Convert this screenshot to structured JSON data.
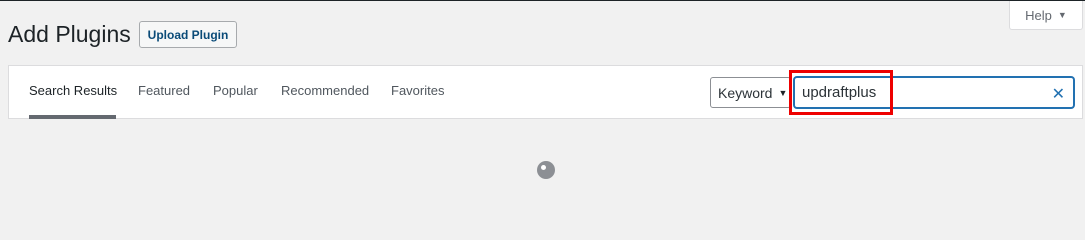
{
  "header": {
    "title": "Add Plugins",
    "upload_button": "Upload Plugin",
    "help_tab": "Help"
  },
  "filter_tabs": [
    {
      "label": "Search Results",
      "current": true
    },
    {
      "label": "Featured",
      "current": false
    },
    {
      "label": "Popular",
      "current": false
    },
    {
      "label": "Recommended",
      "current": false
    },
    {
      "label": "Favorites",
      "current": false
    }
  ],
  "search": {
    "type_selected": "Keyword",
    "value": "updraftplus",
    "clear_icon": "close-icon"
  },
  "icons": {
    "help_caret": "caret-down-icon",
    "select_arrow": "caret-down-icon",
    "loading": "spinner-icon"
  },
  "colors": {
    "accent": "#2271b1",
    "highlight": "#e00000"
  }
}
